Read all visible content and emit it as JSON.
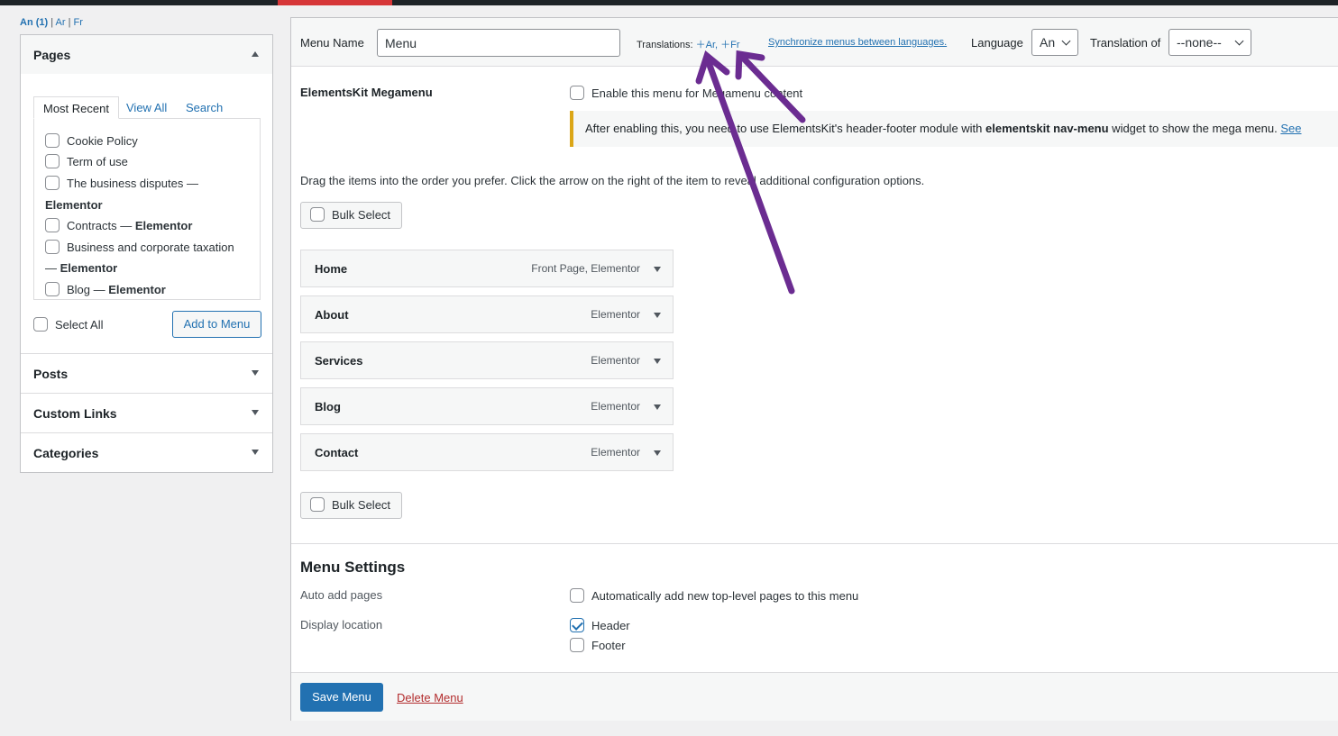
{
  "language_links": {
    "current": "An (1)",
    "ar": "Ar",
    "fr": "Fr",
    "sep": "|"
  },
  "left_panel": {
    "pages": {
      "title": "Pages",
      "tabs": [
        "Most Recent",
        "View All",
        "Search"
      ],
      "items": [
        {
          "pre": "Cookie Policy",
          "bold": ""
        },
        {
          "pre": "Term of use",
          "bold": ""
        },
        {
          "pre": "The business disputes —",
          "bold": "Elementor"
        },
        {
          "pre": "Contracts — ",
          "bold": "Elementor"
        },
        {
          "pre": "Business and corporate taxation",
          "line2pre": "— ",
          "bold": "Elementor"
        },
        {
          "pre": "Blog — ",
          "bold": "Elementor"
        }
      ],
      "select_all": "Select All",
      "add_button": "Add to Menu"
    },
    "posts": "Posts",
    "custom_links": "Custom Links",
    "categories": "Categories"
  },
  "menu_header": {
    "name_label": "Menu Name",
    "name_value": "Menu",
    "translations_label": "Translations:",
    "translation_ar": "Ar,",
    "translation_fr": "Fr",
    "sync_link": "Synchronize menus between languages.",
    "language_label": "Language",
    "language_value": "An",
    "translation_of_label": "Translation of",
    "translation_of_value": "--none--"
  },
  "elementskit": {
    "title": "ElementsKit Megamenu",
    "enable_label": "Enable this menu for Megamenu content",
    "notice_pre": "After enabling this, you need to use ElementsKit's header-footer module with ",
    "notice_bold": "elementskit nav-menu",
    "notice_post": " widget to show the mega menu. ",
    "notice_link": "See"
  },
  "drag_instructions": "Drag the items into the order you prefer. Click the arrow on the right of the item to reveal additional configuration options.",
  "bulk_select": "Bulk Select",
  "menu_items": [
    {
      "title": "Home",
      "meta": "Front Page, Elementor"
    },
    {
      "title": "About",
      "meta": "Elementor"
    },
    {
      "title": "Services",
      "meta": "Elementor"
    },
    {
      "title": "Blog",
      "meta": "Elementor"
    },
    {
      "title": "Contact",
      "meta": "Elementor"
    }
  ],
  "menu_settings": {
    "title": "Menu Settings",
    "auto_add_label": "Auto add pages",
    "auto_add_option": "Automatically add new top-level pages to this menu",
    "display_location_label": "Display location",
    "locations": [
      {
        "label": "Header",
        "checked": true
      },
      {
        "label": "Footer",
        "checked": false
      }
    ]
  },
  "footer": {
    "save": "Save Menu",
    "delete": "Delete Menu"
  },
  "colors": {
    "primary": "#2271b1",
    "annotation_arrow": "#6b2c91",
    "admin_bar": "#1d2327",
    "accent": "#d63638"
  }
}
